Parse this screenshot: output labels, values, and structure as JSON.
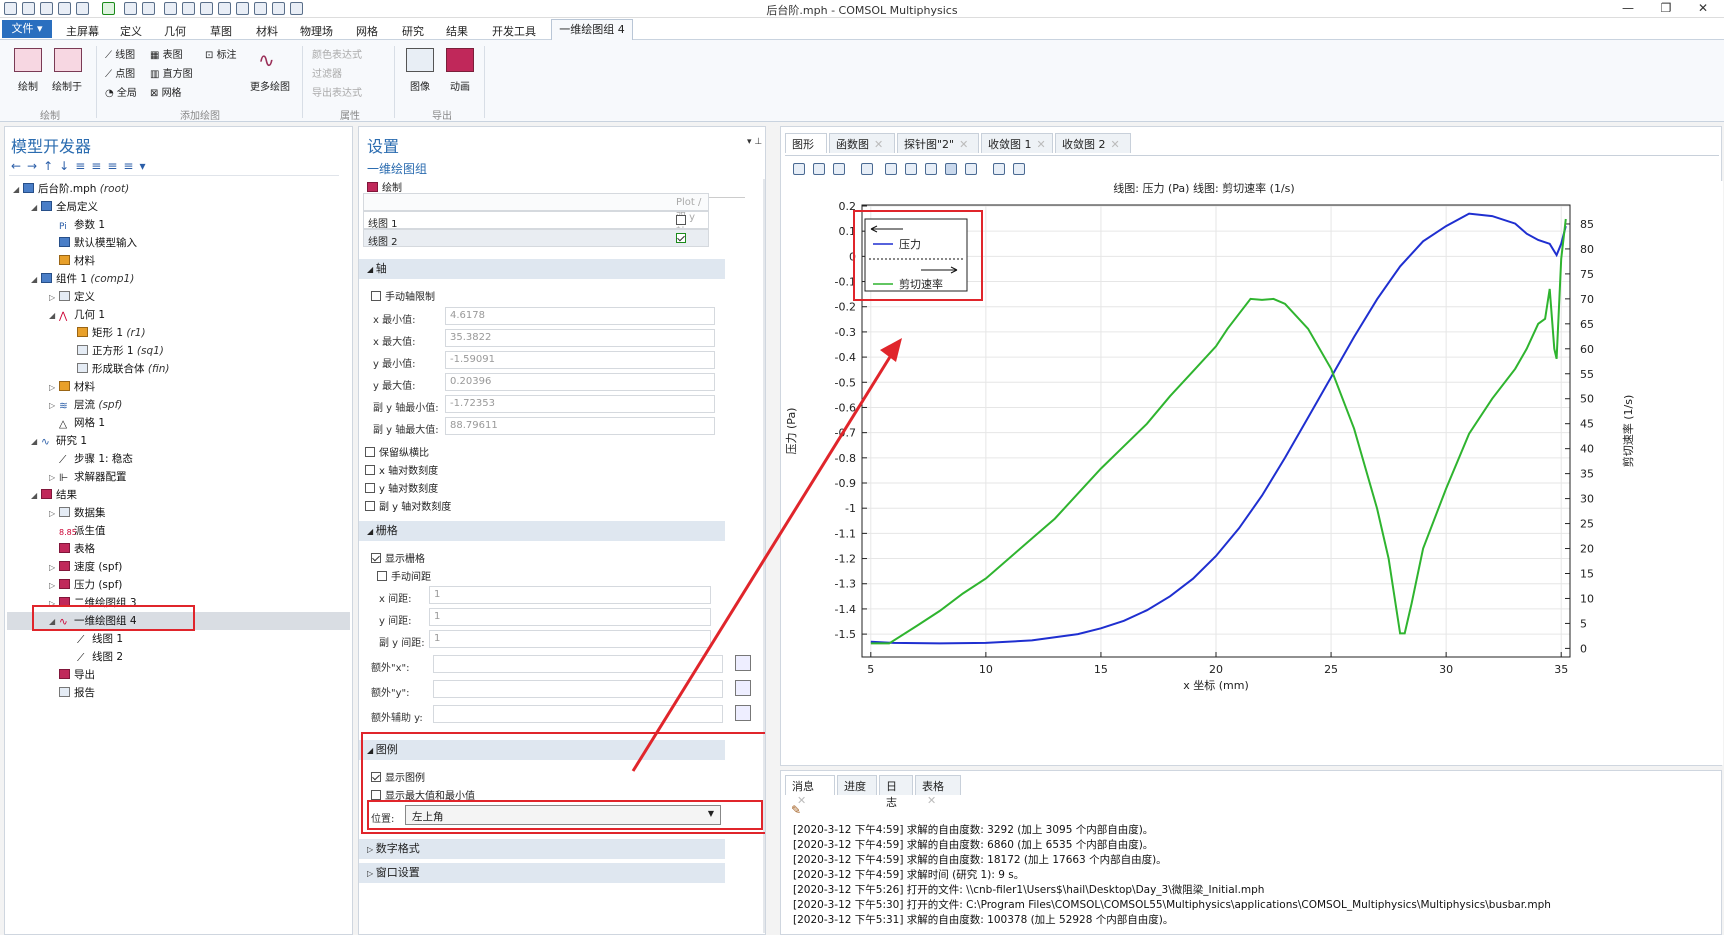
{
  "window": {
    "title": "后台阶.mph - COMSOL Multiphysics"
  },
  "menu": {
    "file": "文件 ▾",
    "items": [
      "主屏幕",
      "定义",
      "几何",
      "草图",
      "材料",
      "物理场",
      "网格",
      "研究",
      "结果",
      "开发工具"
    ],
    "active_tab": "一维绘图组 4"
  },
  "ribbon": {
    "plot": "绘制",
    "plot_in": "绘制于",
    "line_graph": "线图",
    "table_graph": "表图",
    "annotation": "标注",
    "point_graph": "点图",
    "histogram": "直方图",
    "global": "全局",
    "mesh": "网格",
    "more_plots": "更多绘图",
    "color_expr": "颜色表达式",
    "filter": "过滤器",
    "export_expr": "导出表达式",
    "image": "图像",
    "animation": "动画",
    "groups": {
      "plot": "绘制",
      "add_plot": "添加绘图",
      "attributes": "属性",
      "export": "导出"
    }
  },
  "model_builder": {
    "title": "模型开发器",
    "tree": [
      {
        "label": "后台阶.mph",
        "tag": "(root)"
      },
      {
        "label": "全局定义",
        "tag": ""
      },
      {
        "label": "参数 1",
        "tag": ""
      },
      {
        "label": "默认模型输入",
        "tag": ""
      },
      {
        "label": "材料",
        "tag": ""
      },
      {
        "label": "组件 1",
        "tag": "(comp1)"
      },
      {
        "label": "定义",
        "tag": ""
      },
      {
        "label": "几何 1",
        "tag": ""
      },
      {
        "label": "矩形 1",
        "tag": "(r1)"
      },
      {
        "label": "正方形 1",
        "tag": "(sq1)"
      },
      {
        "label": "形成联合体",
        "tag": "(fin)"
      },
      {
        "label": "材料",
        "tag": ""
      },
      {
        "label": "层流",
        "tag": "(spf)"
      },
      {
        "label": "网格 1",
        "tag": ""
      },
      {
        "label": "研究 1",
        "tag": ""
      },
      {
        "label": "步骤 1: 稳态",
        "tag": ""
      },
      {
        "label": "求解器配置",
        "tag": ""
      },
      {
        "label": "结果",
        "tag": ""
      },
      {
        "label": "数据集",
        "tag": ""
      },
      {
        "label": "派生值",
        "tag": ""
      },
      {
        "label": "表格",
        "tag": ""
      },
      {
        "label": "速度 (spf)",
        "tag": ""
      },
      {
        "label": "压力 (spf)",
        "tag": ""
      },
      {
        "label": "二维绘图组 3",
        "tag": ""
      },
      {
        "label": "一维绘图组 4",
        "tag": ""
      },
      {
        "label": "线图 1",
        "tag": ""
      },
      {
        "label": "线图 2",
        "tag": ""
      },
      {
        "label": "导出",
        "tag": ""
      },
      {
        "label": "报告",
        "tag": ""
      }
    ]
  },
  "settings": {
    "title": "设置",
    "subtitle": "一维绘图组",
    "plot_btn": "绘制",
    "table_header": "Plot / 双 y 轴",
    "plots": [
      {
        "name": "线图 1",
        "checked": false
      },
      {
        "name": "线图 2",
        "checked": true
      }
    ],
    "axis": {
      "header": "轴",
      "manual": "手动轴限制",
      "labels": [
        "x 最小值:",
        "x 最大值:",
        "y 最小值:",
        "y 最大值:",
        "副 y 轴最小值:",
        "副 y 轴最大值:"
      ],
      "values": [
        "4.6178",
        "35.3822",
        "-1.59091",
        "0.20396",
        "-1.72353",
        "88.79611"
      ],
      "keep_aspect": "保留纵横比",
      "x_log": "x 轴对数刻度",
      "y_log": "y 轴对数刻度",
      "y2_log": "副 y 轴对数刻度"
    },
    "grid": {
      "header": "栅格",
      "show": "显示栅格",
      "manual": "手动间距",
      "labels": [
        "x 间距:",
        "y 间距:",
        "副 y 间距:"
      ],
      "values": [
        "1",
        "1",
        "1"
      ],
      "extra_labels": [
        "额外\"x\":",
        "额外\"y\":",
        "额外辅助 y:"
      ]
    },
    "legend": {
      "header": "图例",
      "show": "显示图例",
      "minmax": "显示最大值和最小值",
      "pos_label": "位置:",
      "position": "左上角"
    },
    "number_format": "数字格式",
    "window_settings": "窗口设置"
  },
  "graphics": {
    "tabs": [
      "图形",
      "函数图",
      "探针图\"2\"",
      "收敛图 1",
      "收敛图 2"
    ],
    "plot_title": "线图: 压力 (Pa) 线图: 剪切速率 (1/s)",
    "xlabel": "x 坐标 (mm)",
    "ylabel": "压力 (Pa)",
    "y2label": "剪切速率 (1/s)",
    "legend": {
      "s1": "压力",
      "s2": "剪切速率"
    }
  },
  "chart_data": {
    "type": "line",
    "title": "线图: 压力 (Pa) 线图: 剪切速率 (1/s)",
    "xlabel": "x 坐标 (mm)",
    "ylabel": "压力 (Pa)",
    "y2label": "剪切速率 (1/s)",
    "xlim": [
      4.6178,
      35.3822
    ],
    "ylim": [
      -1.59091,
      0.20396
    ],
    "y2lim": [
      -1.72353,
      88.79611
    ],
    "x_ticks": [
      5,
      10,
      15,
      20,
      25,
      30,
      35
    ],
    "y_ticks": [
      0.2,
      0.1,
      0,
      -0.1,
      -0.2,
      -0.3,
      -0.4,
      -0.5,
      -0.6,
      -0.7,
      -0.8,
      -0.9,
      -1,
      -1.1,
      -1.2,
      -1.3,
      -1.4,
      -1.5
    ],
    "y2_ticks": [
      85,
      80,
      75,
      70,
      65,
      60,
      55,
      50,
      45,
      40,
      35,
      30,
      25,
      20,
      15,
      10,
      5,
      0
    ],
    "grid": true,
    "legend_position": "top-left",
    "series": [
      {
        "name": "压力",
        "axis": "left",
        "color": "#1f2fd0",
        "x": [
          5,
          6,
          8,
          10,
          12,
          14,
          15,
          16,
          17,
          18,
          19,
          20,
          21,
          22,
          23,
          24,
          25,
          26,
          27,
          28,
          29,
          30,
          31,
          32,
          33,
          33.5,
          34,
          34.5,
          34.8,
          35,
          35.2
        ],
        "y": [
          -1.53,
          -1.535,
          -1.537,
          -1.535,
          -1.525,
          -1.5,
          -1.477,
          -1.447,
          -1.405,
          -1.35,
          -1.28,
          -1.19,
          -1.08,
          -0.95,
          -0.8,
          -0.64,
          -0.48,
          -0.32,
          -0.17,
          -0.04,
          0.06,
          0.12,
          0.17,
          0.16,
          0.13,
          0.09,
          0.065,
          0.05,
          0.005,
          0.05,
          0.12
        ]
      },
      {
        "name": "剪切速率",
        "axis": "right",
        "color": "#2fb42f",
        "x": [
          5,
          5.8,
          7,
          8,
          9,
          10,
          11,
          12,
          13,
          14,
          15,
          16,
          17,
          18,
          19,
          20,
          20.5,
          21,
          21.5,
          22,
          22.5,
          23,
          24,
          25,
          26,
          27,
          27.5,
          28,
          28.2,
          28.5,
          29,
          30,
          31,
          32,
          33,
          33.5,
          34,
          34.3,
          34.5,
          34.7,
          34.8,
          35,
          35.2
        ],
        "y": [
          1,
          1,
          4.5,
          7.5,
          11,
          14,
          18,
          22,
          26,
          31,
          36,
          40.5,
          45,
          50.5,
          55.5,
          60.5,
          64,
          67,
          70,
          69.8,
          70,
          69,
          64,
          56,
          44,
          28,
          18,
          3,
          3,
          9,
          20,
          32,
          43,
          50,
          56,
          60,
          65,
          66,
          72,
          60,
          58,
          78,
          86
        ]
      }
    ]
  },
  "messages": {
    "tabs": [
      "消息",
      "进度",
      "日志",
      "表格"
    ],
    "lines": [
      "[2020-3-12 下午4:59] 求解的自由度数: 3292 (加上 3095 个内部自由度)。",
      "[2020-3-12 下午4:59] 求解的自由度数: 6860 (加上 6535 个内部自由度)。",
      "[2020-3-12 下午4:59] 求解的自由度数: 18172 (加上 17663 个内部自由度)。",
      "[2020-3-12 下午4:59] 求解时间 (研究 1): 9 s。",
      "[2020-3-12 下午5:26] 打开的文件: \\\\cnb-filer1\\Users$\\hail\\Desktop\\Day_3\\微阻梁_Initial.mph",
      "[2020-3-12 下午5:30] 打开的文件: C:\\Program Files\\COMSOL\\COMSOL55\\Multiphysics\\applications\\COMSOL_Multiphysics\\Multiphysics\\busbar.mph",
      "[2020-3-12 下午5:31] 求解的自由度数: 100378 (加上 52928 个内部自由度)。"
    ]
  }
}
